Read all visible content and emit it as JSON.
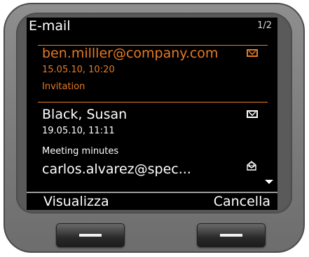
{
  "header": {
    "title": "E-mail",
    "page_indicator": "1/2"
  },
  "emails": [
    {
      "sender": "ben.milller@company.com",
      "date": "15.05.10, 10:20",
      "subject": "Invitation",
      "icon": "mail-icon",
      "selected": true
    },
    {
      "sender": "Black, Susan",
      "date": "19.05.10, 11:11",
      "subject": "Meeting minutes",
      "icon": "mail-icon",
      "selected": false
    },
    {
      "sender": "carlos.alvarez@spec...",
      "icon": "open-mail-icon",
      "selected": false
    }
  ],
  "softkeys": {
    "left": "Visualizza",
    "right": "Cancella"
  },
  "colors": {
    "accent": "#e87a22",
    "screen_bg": "#000000",
    "text": "#ffffff"
  }
}
